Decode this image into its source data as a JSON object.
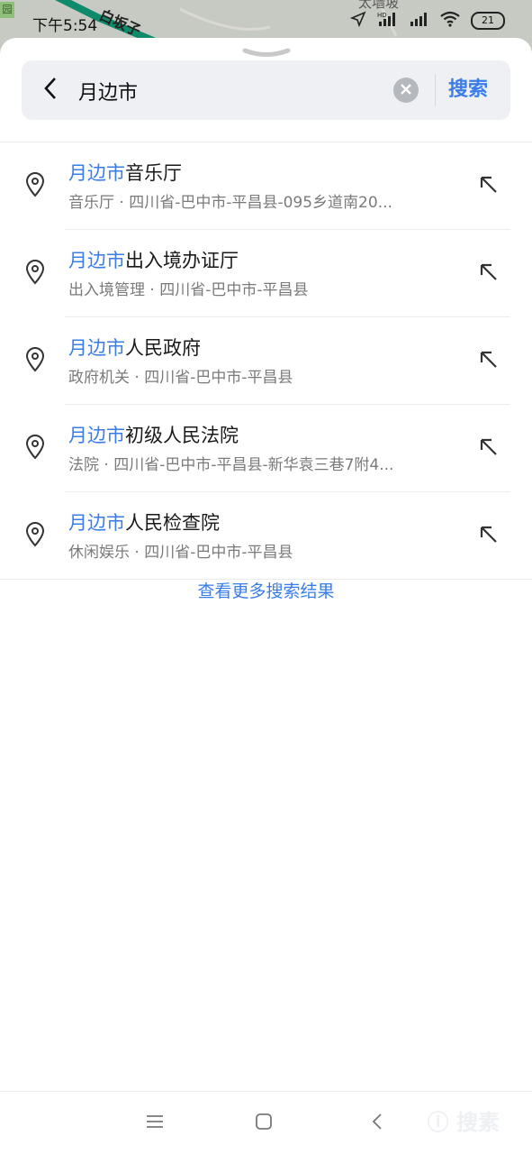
{
  "status_bar": {
    "time": "下午5:54",
    "battery": "21",
    "map_label": "太墙坡",
    "park_badge": "园",
    "road_label": "白坂子"
  },
  "search": {
    "query": "月边市",
    "search_button_label": "搜索"
  },
  "results": [
    {
      "highlight": "月边市",
      "rest": "音乐厅",
      "subtitle": "音乐厅 · 四川省-巴中市-平昌县-095乡道南20..."
    },
    {
      "highlight": "月边市",
      "rest": "出入境办证厅",
      "subtitle": "出入境管理 · 四川省-巴中市-平昌县"
    },
    {
      "highlight": "月边市",
      "rest": "人民政府",
      "subtitle": "政府机关 · 四川省-巴中市-平昌县"
    },
    {
      "highlight": "月边市",
      "rest": "初级人民法院",
      "subtitle": "法院 · 四川省-巴中市-平昌县-新华袁三巷7附4..."
    },
    {
      "highlight": "月边市",
      "rest": "人民检查院",
      "subtitle": "休闲娱乐 · 四川省-巴中市-平昌县"
    }
  ],
  "more_results_label": "查看更多搜索结果",
  "watermark": "ⓘ 搜素",
  "colors": {
    "accent": "#3a7de8",
    "text_primary": "#1a1a1a",
    "text_secondary": "#7a7a7a",
    "search_bg": "#eef0f4"
  },
  "icons": {
    "back": "chevron-left-icon",
    "clear": "clear-icon",
    "pin": "location-pin-icon",
    "fill": "arrow-up-left-icon",
    "menu": "menu-icon",
    "home": "home-icon",
    "nav_back": "nav-back-icon"
  }
}
